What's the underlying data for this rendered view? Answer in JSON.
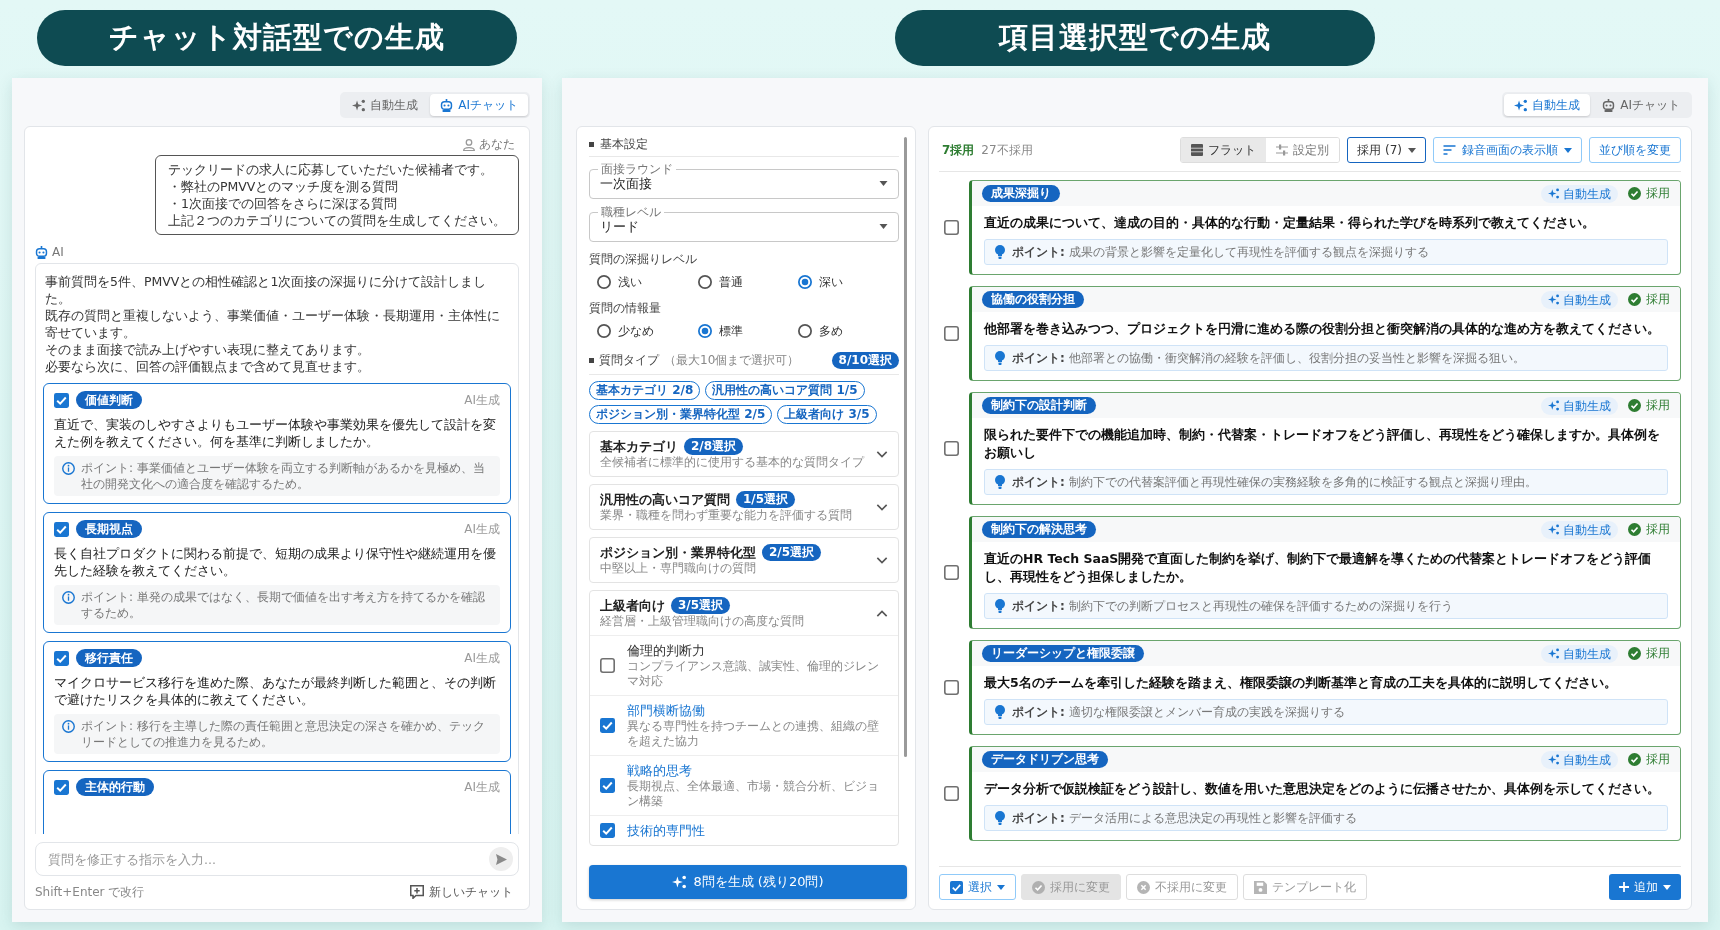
{
  "headings": [
    {
      "text": "チャット対話型での生成"
    },
    {
      "text": "項目選択型での生成"
    }
  ],
  "chat_screen": {
    "mode_toggle": [
      {
        "label": "自動生成",
        "kind": "auto",
        "selected": false
      },
      {
        "label": "AIチャット",
        "kind": "chat",
        "selected": true
      }
    ],
    "user_label": "あなた",
    "user_message": [
      "テックリードの求人に応募していただいた候補者です。",
      "・弊社のPMVVとのマッチ度を測る質問",
      "・1次面接での回答をさらに深ぼる質問",
      "上記２つのカテゴリについての質問を生成してください。"
    ],
    "ai_label": "AI",
    "ai_message": [
      "事前質問を5件、PMVVとの相性確認と1次面接の深掘りに分けて設計しました。",
      "既存の質問と重複しないよう、事業価値・ユーザー体験・長期運用・主体性に寄せています。",
      "そのまま面接で読み上げやすい表現に整えてあります。",
      "必要なら次に、回答の評価観点まで含めて見直せます。"
    ],
    "questions": [
      {
        "tag": "価値判断",
        "source": "AI生成",
        "checked": true,
        "text": "直近で、実装のしやすさよりもユーザー体験や事業効果を優先して設計を変えた例を教えてください。何を基準に判断しましたか。",
        "point": "ポイント: 事業価値とユーザー体験を両立する判断軸があるかを見極め、当社の開発文化への適合度を確認するため。"
      },
      {
        "tag": "長期視点",
        "source": "AI生成",
        "checked": true,
        "text": "長く自社プロダクトに関わる前提で、短期の成果より保守性や継続運用を優先した経験を教えてください。",
        "point": "ポイント: 単発の成果ではなく、長期で価値を出す考え方を持てるかを確認するため。"
      },
      {
        "tag": "移行責任",
        "source": "AI生成",
        "checked": true,
        "text": "マイクロサービス移行を進めた際、あなたが最終判断した範囲と、その判断で避けたリスクを具体的に教えてください。",
        "point": "ポイント: 移行を主導した際の責任範囲と意思決定の深さを確かめ、テックリードとしての推進力を見るため。"
      },
      {
        "tag": "主体的行動",
        "source": "AI生成",
        "checked": true
      }
    ],
    "input": {
      "placeholder": "質問を修正する指示を入力..."
    },
    "shortcut_hint": "Shift+Enter で改行",
    "new_chat": "新しいチャット"
  },
  "select_screen": {
    "mode_toggle": [
      {
        "label": "自動生成",
        "kind": "auto",
        "selected": true
      },
      {
        "label": "AIチャット",
        "kind": "chat",
        "selected": false
      }
    ],
    "settings": {
      "section_title": "基本設定",
      "selects": [
        {
          "label": "面接ラウンド",
          "value": "一次面接"
        },
        {
          "label": "職種レベル",
          "value": "リード"
        }
      ],
      "radio_groups": [
        {
          "label": "質問の深掘りレベル",
          "options": [
            {
              "label": "浅い",
              "selected": false
            },
            {
              "label": "普通",
              "selected": false
            },
            {
              "label": "深い",
              "selected": true
            }
          ]
        },
        {
          "label": "質問の情報量",
          "options": [
            {
              "label": "少なめ",
              "selected": false
            },
            {
              "label": "標準",
              "selected": true
            },
            {
              "label": "多め",
              "selected": false
            }
          ]
        }
      ],
      "question_types": {
        "title": "質問タイプ",
        "note": "（最大10個まで選択可）",
        "count": "8/10選択",
        "chips": [
          "基本カテゴリ 2/8",
          "汎用性の高いコア質問 1/5",
          "ポジション別・業界特化型 2/5",
          "上級者向け 3/5"
        ],
        "categories": [
          {
            "name": "基本カテゴリ",
            "count": "2/8選択",
            "description": "全候補者に標準的に使用する基本的な質問タイプ",
            "expanded": false
          },
          {
            "name": "汎用性の高いコア質問",
            "count": "1/5選択",
            "description": "業界・職種を問わず重要な能力を評価する質問",
            "expanded": false
          },
          {
            "name": "ポジション別・業界特化型",
            "count": "2/5選択",
            "description": "中堅以上・専門職向けの質問",
            "expanded": false
          },
          {
            "name": "上級者向け",
            "count": "3/5選択",
            "description": "経営層・上級管理職向けの高度な質問",
            "expanded": true,
            "items": [
              {
                "name": "倫理的判断力",
                "description": "コンプライアンス意識、誠実性、倫理的ジレンマ対応",
                "checked": false
              },
              {
                "name": "部門横断協働",
                "description": "異なる専門性を持つチームとの連携、組織の壁を超えた協力",
                "checked": true
              },
              {
                "name": "戦略的思考",
                "description": "長期視点、全体最適、市場・競合分析、ビジョン構築",
                "checked": true
              },
              {
                "name": "技術的専門性",
                "checked": true
              }
            ]
          }
        ]
      },
      "generate_button": "8問を生成 (残り20問)"
    },
    "main": {
      "adopted_count": "7採用",
      "rejected_count": "27不採用",
      "view_toggle": [
        {
          "label": "フラット",
          "kind": "flat",
          "selected": true
        },
        {
          "label": "設定別",
          "kind": "grouped",
          "selected": false
        }
      ],
      "filter": "採用 (7)",
      "sort": "録音画面の表示順",
      "reorder": "並び順を変更",
      "questions": [
        {
          "tag": "成果深掘り",
          "source": "自動生成",
          "status": "採用",
          "adopted": true,
          "checked": false,
          "text": "直近の成果について、達成の目的・具体的な行動・定量結果・得られた学びを時系列で教えてください。",
          "point": "**ポイント:** 成果の背景と影響を定量化して再現性を評価する観点を深掘りする"
        },
        {
          "tag": "協働の役割分担",
          "source": "自動生成",
          "status": "採用",
          "adopted": true,
          "checked": false,
          "text": "他部署を巻き込みつつ、プロジェクトを円滑に進める際の役割分担と衝突解消の具体的な進め方を教えてください。",
          "point": "**ポイント:** 他部署との協働・衝突解消の経験を評価し、役割分担の妥当性と影響を深掘る狙い。"
        },
        {
          "tag": "制約下の設計判断",
          "source": "自動生成",
          "status": "採用",
          "adopted": true,
          "checked": false,
          "text": "限られた要件下での機能追加時、制約・代替案・トレードオフをどう評価し、再現性をどう確保しますか。具体例をお願いし",
          "point": "**ポイント:** 制約下での代替案評価と再現性確保の実務経験を多角的に検証する観点と深掘り理由。"
        },
        {
          "tag": "制約下の解決思考",
          "source": "自動生成",
          "status": "採用",
          "adopted": true,
          "checked": false,
          "text": "直近のHR Tech SaaS開発で直面した制約を挙げ、制約下で最適解を導くための代替案とトレードオフをどう評価し、再現性をどう担保しましたか。",
          "point": "**ポイント:** 制約下での判断プロセスと再現性の確保を評価するための深掘りを行う"
        },
        {
          "tag": "リーダーシップと権限委譲",
          "source": "自動生成",
          "status": "採用",
          "adopted": true,
          "checked": false,
          "text": "最大5名のチームを牽引した経験を踏まえ、権限委譲の判断基準と育成の工夫を具体的に説明してください。",
          "point": "**ポイント:** 適切な権限委譲とメンバー育成の実践を深掘りする"
        },
        {
          "tag": "データドリブン思考",
          "source": "自動生成",
          "status": "採用",
          "adopted": true,
          "checked": false,
          "text": "データ分析で仮説検証をどう設計し、数値を用いた意思決定をどのように伝播させたか、具体例を示してください。",
          "point": "**ポイント:** データ活用による意思決定の再現性と影響を評価する"
        }
      ],
      "actions": [
        {
          "label": "選択",
          "kind": "select",
          "disabled": false
        },
        {
          "label": "採用に変更",
          "kind": "adopt",
          "disabled": true
        },
        {
          "label": "不採用に変更",
          "kind": "reject",
          "disabled": true
        },
        {
          "label": "テンプレート化",
          "kind": "template",
          "disabled": true
        }
      ],
      "add_button": "追加"
    }
  }
}
